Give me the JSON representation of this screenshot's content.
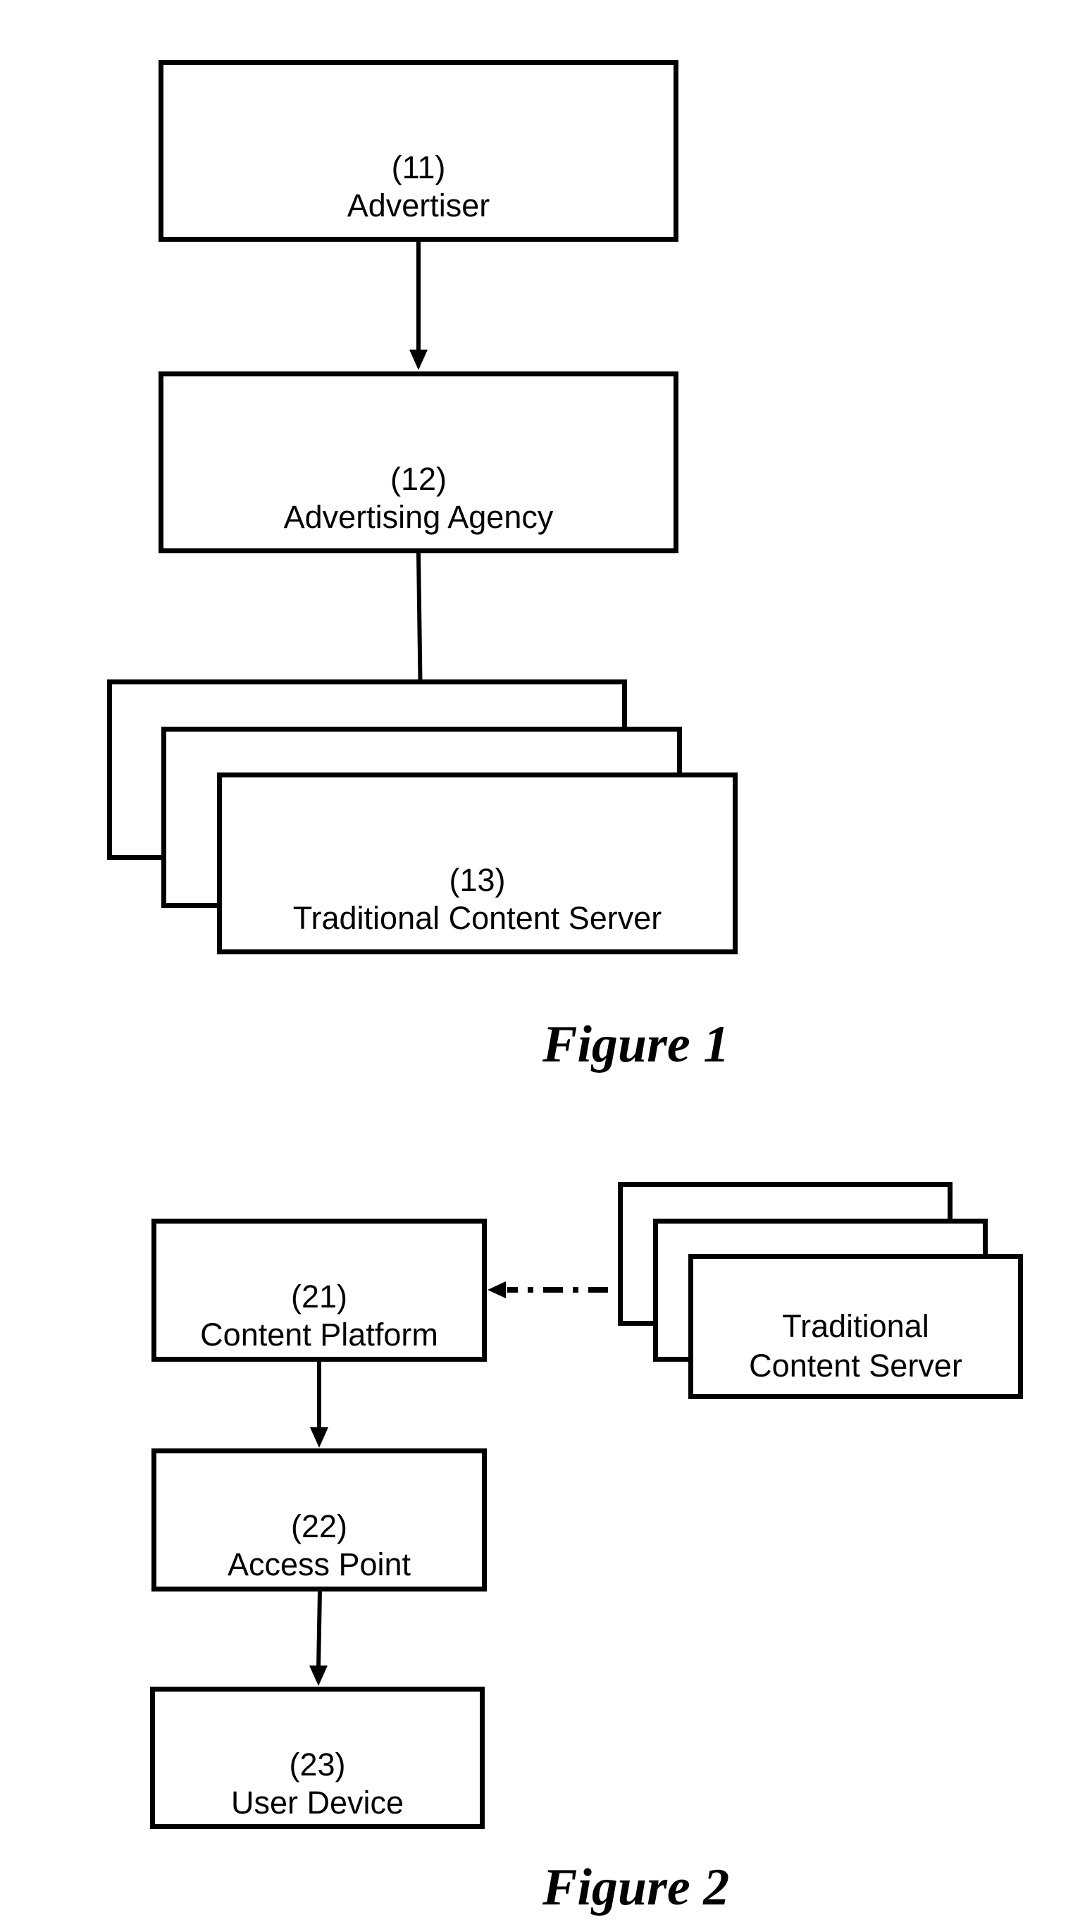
{
  "figure1": {
    "caption": "Figure 1",
    "nodes": [
      {
        "id": "11",
        "ref": "(11)",
        "label": "Advertiser"
      },
      {
        "id": "12",
        "ref": "(12)",
        "label": "Advertising Agency"
      },
      {
        "id": "13",
        "ref": "(13)",
        "label": "Traditional Content Server",
        "stacked": true
      }
    ],
    "edges": [
      {
        "from": "11",
        "to": "12",
        "style": "solid"
      },
      {
        "from": "12",
        "to": "13",
        "style": "solid"
      }
    ]
  },
  "figure2": {
    "caption": "Figure 2",
    "nodes": [
      {
        "id": "21",
        "ref": "(21)",
        "label": "Content Platform"
      },
      {
        "id": "22",
        "ref": "(22)",
        "label": "Access Point"
      },
      {
        "id": "23",
        "ref": "(23)",
        "label": "User Device"
      },
      {
        "id": "tcs",
        "line1": "Traditional",
        "line2": "Content Server",
        "stacked": true
      }
    ],
    "edges": [
      {
        "from": "tcs",
        "to": "21",
        "style": "dash-dot"
      },
      {
        "from": "21",
        "to": "22",
        "style": "solid"
      },
      {
        "from": "22",
        "to": "23",
        "style": "solid"
      }
    ]
  }
}
